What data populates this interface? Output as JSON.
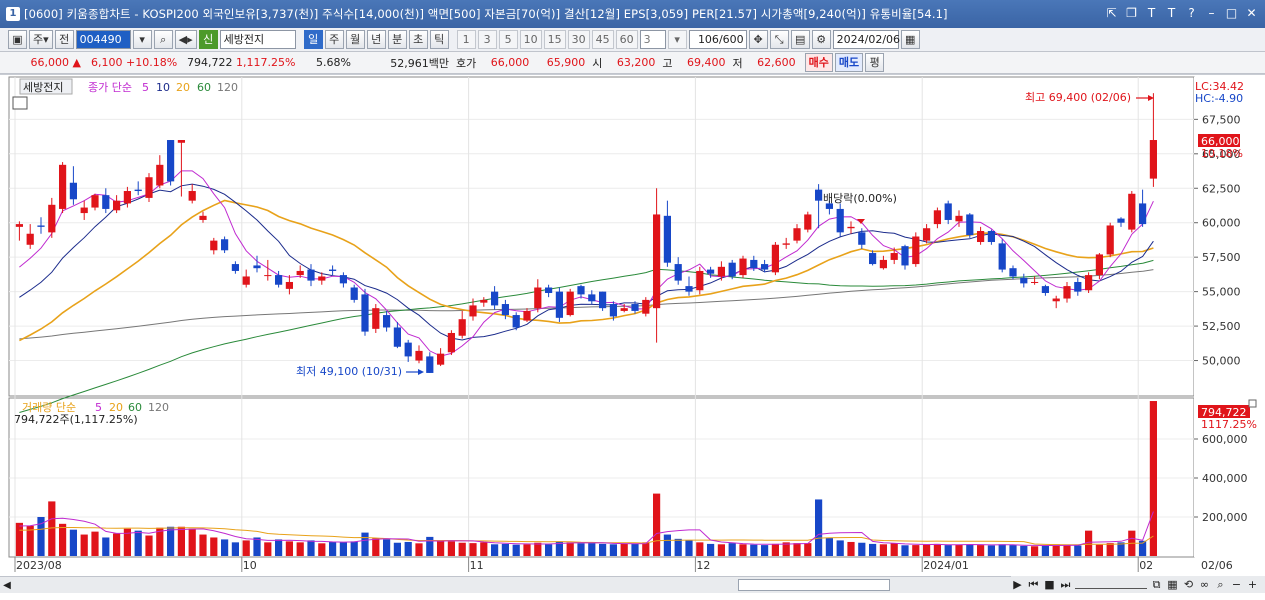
{
  "window": {
    "title": "[0600] 키움종합차트 - KOSPI200 외국인보유[3,737(천)] 주식수[14,000(천)] 액면[500] 자본금[70(억)] 결산[12월] EPS[3,059] PER[21.57] 시가총액[9,240(억)] 유통비율[54.1]",
    "app_icon": "1"
  },
  "toolbar": {
    "jeon_label": "전",
    "code": "004490",
    "stock_name": "세방전지",
    "sin_label": "신",
    "period_buttons": [
      "일",
      "주",
      "월",
      "년"
    ],
    "intraday_buttons": [
      "분",
      "초",
      "틱"
    ],
    "minute_options": [
      "1",
      "3",
      "5",
      "10",
      "15",
      "30",
      "45",
      "60"
    ],
    "interval_value": "3",
    "count_display": "106",
    "count_total": "/600",
    "date": "2024/02/06"
  },
  "quote": {
    "price": "66,000",
    "change": "6,100",
    "change_pct": "+10.18%",
    "volume": "794,722",
    "volume_pct": "1,117.25%",
    "turnover": "5.68%",
    "amount": "52,961백만",
    "hoga_label": "호가",
    "ask": "66,000",
    "bid": "65,900",
    "open_label": "시",
    "open": "63,200",
    "high_label": "고",
    "high": "69,400",
    "low_label": "저",
    "low": "62,600",
    "buy_label": "매수",
    "sell_label": "매도",
    "eval_label": "평"
  },
  "price_panel": {
    "stock_tag": "세방전지",
    "legend_prefix": "종가 단순",
    "ma_periods": [
      "5",
      "10",
      "20",
      "60",
      "120"
    ],
    "lc_label": "LC:34.42",
    "hc_label": "HC:-4.90",
    "last_price_tag": "66,000",
    "last_pct_tag": "10.18%",
    "max_label": "최고 69,400 (02/06)",
    "min_label": "최저 49,100 (10/31)",
    "dividend_label": "배당락(0.00%)",
    "y_ticks": [
      "67,500",
      "65,000",
      "62,500",
      "60,000",
      "57,500",
      "55,000",
      "52,500",
      "50,000"
    ]
  },
  "volume_panel": {
    "legend_prefix": "거래량 단순",
    "ma_periods": [
      "5",
      "20",
      "60",
      "120"
    ],
    "current_label": "794,722주(1,117.25%)",
    "last_tag": "794,722",
    "last_pct_tag": "1117.25%",
    "y_ticks": [
      "600,000",
      "400,000",
      "200,000"
    ]
  },
  "x_axis": {
    "labels": [
      "2023/08",
      "10",
      "11",
      "12",
      "2024/01",
      "02"
    ],
    "right_label": "02/06"
  },
  "colors": {
    "up": "#e0141a",
    "down": "#1747c8",
    "ma5": "#c02ad0",
    "ma10": "#1c2c8c",
    "ma20": "#e8a21a",
    "ma60": "#2a8a3a",
    "ma120": "#777777"
  },
  "chart_data": {
    "type": "candlestick",
    "y_range": [
      47500,
      70500
    ],
    "volume_range": [
      0,
      800000
    ],
    "closes": [
      59900,
      59200,
      59700,
      61300,
      64200,
      61700,
      61100,
      62000,
      61000,
      61600,
      62300,
      62300,
      63300,
      64200,
      63000,
      66000,
      62300,
      60500,
      58700,
      58000,
      56500,
      56100,
      56700,
      56200,
      55500,
      55700,
      56500,
      55800,
      56100,
      56500,
      55600,
      54400,
      52100,
      53800,
      52400,
      51000,
      50300,
      50700,
      49100,
      50500,
      52000,
      53000,
      54000,
      54400,
      54000,
      53300,
      52400,
      53600,
      55300,
      54900,
      53100,
      55000,
      54800,
      54300,
      53800,
      53200,
      53800,
      53600,
      54400,
      60600,
      57100,
      55800,
      55000,
      56500,
      56300,
      56800,
      56100,
      57400,
      56700,
      56600,
      58400,
      58500,
      59600,
      60600,
      61600,
      61000,
      59300,
      59700,
      58400,
      57000,
      57300,
      57800,
      56900,
      59000,
      59600,
      60900,
      60200,
      60500,
      59100,
      59400,
      58600,
      56600,
      56100,
      55600,
      55700,
      54900,
      54500,
      55400,
      55000,
      56200,
      57700,
      59800,
      60000,
      62100,
      59900,
      66000
    ],
    "opens": [
      59700,
      58400,
      59800,
      59300,
      61000,
      62900,
      60700,
      61100,
      62000,
      60900,
      61400,
      62400,
      61800,
      62700,
      66000,
      65800,
      61600,
      60200,
      58000,
      58800,
      57000,
      55500,
      56900,
      56200,
      56200,
      55200,
      56200,
      56600,
      55800,
      56600,
      56200,
      55300,
      54800,
      52300,
      53300,
      52400,
      51300,
      50000,
      50300,
      49700,
      50600,
      51800,
      53200,
      54200,
      55000,
      54100,
      53300,
      52900,
      53800,
      55300,
      55000,
      53300,
      55400,
      54800,
      55000,
      54100,
      53600,
      54100,
      53400,
      53800,
      60500,
      57000,
      55400,
      55100,
      56600,
      56100,
      57100,
      56200,
      57300,
      57000,
      56400,
      58400,
      58700,
      59500,
      62400,
      61400,
      61000,
      59600,
      59300,
      57800,
      56700,
      57300,
      58300,
      57000,
      58700,
      59900,
      61400,
      60100,
      60600,
      58600,
      59400,
      58500,
      56700,
      56000,
      55700,
      55400,
      54300,
      54500,
      55700,
      55100,
      56200,
      57700,
      60300,
      59500,
      61400,
      63200
    ],
    "highs": [
      60100,
      59900,
      60400,
      61800,
      64400,
      64100,
      61600,
      62100,
      62500,
      62000,
      62600,
      63000,
      63600,
      64900,
      66000,
      66000,
      62800,
      60800,
      58900,
      59000,
      57200,
      56600,
      57600,
      57300,
      56500,
      56200,
      56900,
      57000,
      56400,
      56900,
      56400,
      55500,
      55200,
      54100,
      53600,
      52800,
      51500,
      51100,
      50600,
      50900,
      52200,
      53600,
      54500,
      54600,
      55400,
      54400,
      53500,
      53800,
      55900,
      55500,
      55300,
      55200,
      55500,
      55100,
      55000,
      54300,
      54100,
      54300,
      54600,
      62500,
      61600,
      57500,
      56100,
      56800,
      56800,
      57200,
      57300,
      57600,
      57600,
      57300,
      58600,
      58900,
      59900,
      60800,
      62800,
      61600,
      61400,
      60100,
      59600,
      58000,
      57600,
      58200,
      58400,
      59300,
      59900,
      61100,
      61600,
      60900,
      60700,
      59700,
      59500,
      58800,
      56900,
      56300,
      56100,
      55500,
      54700,
      55700,
      56000,
      56400,
      57800,
      60000,
      60400,
      62300,
      62400,
      69400
    ],
    "lows": [
      58700,
      58100,
      59200,
      58900,
      60700,
      61300,
      60200,
      60900,
      60700,
      60700,
      61100,
      62000,
      61500,
      62500,
      62700,
      61900,
      61400,
      60000,
      57700,
      57800,
      56300,
      55300,
      56400,
      55800,
      55300,
      54800,
      56000,
      55400,
      55500,
      56200,
      55300,
      54200,
      51800,
      52000,
      52100,
      50900,
      49900,
      49800,
      49100,
      49600,
      50400,
      51600,
      52900,
      53900,
      53700,
      53000,
      52200,
      52800,
      53500,
      54600,
      52800,
      53200,
      54500,
      54100,
      53600,
      52900,
      53500,
      53400,
      53200,
      51300,
      56800,
      55500,
      54700,
      54800,
      56000,
      55800,
      55900,
      56000,
      56500,
      56400,
      56200,
      58100,
      58500,
      59300,
      59600,
      60600,
      59000,
      59200,
      58100,
      56900,
      56600,
      57000,
      56600,
      56800,
      58500,
      59600,
      59900,
      59700,
      58900,
      58400,
      58400,
      56400,
      55900,
      55300,
      55500,
      54700,
      53800,
      54200,
      54700,
      54900,
      55900,
      57500,
      59700,
      59300,
      59700,
      62600
    ],
    "volumes": [
      170000,
      155000,
      200000,
      280000,
      165000,
      135000,
      110000,
      125000,
      95000,
      115000,
      140000,
      130000,
      105000,
      145000,
      150000,
      150000,
      140000,
      110000,
      95000,
      85000,
      70000,
      80000,
      95000,
      70000,
      85000,
      75000,
      70000,
      80000,
      65000,
      72000,
      70000,
      75000,
      120000,
      90000,
      85000,
      68000,
      72000,
      65000,
      98000,
      80000,
      75000,
      68000,
      66000,
      70000,
      60000,
      62000,
      58000,
      60000,
      68000,
      60000,
      75000,
      70000,
      65000,
      66000,
      62000,
      60000,
      64000,
      62000,
      70000,
      320000,
      110000,
      88000,
      80000,
      70000,
      62000,
      60000,
      66000,
      60000,
      58000,
      56000,
      62000,
      70000,
      66000,
      66000,
      290000,
      92000,
      80000,
      72000,
      68000,
      62000,
      60000,
      66000,
      55000,
      56000,
      58000,
      62000,
      56000,
      58000,
      60000,
      56000,
      54000,
      60000,
      56000,
      52000,
      50000,
      52000,
      60000,
      58000,
      54000,
      130000,
      58000,
      66000,
      70000,
      130000,
      78000,
      794722
    ]
  }
}
